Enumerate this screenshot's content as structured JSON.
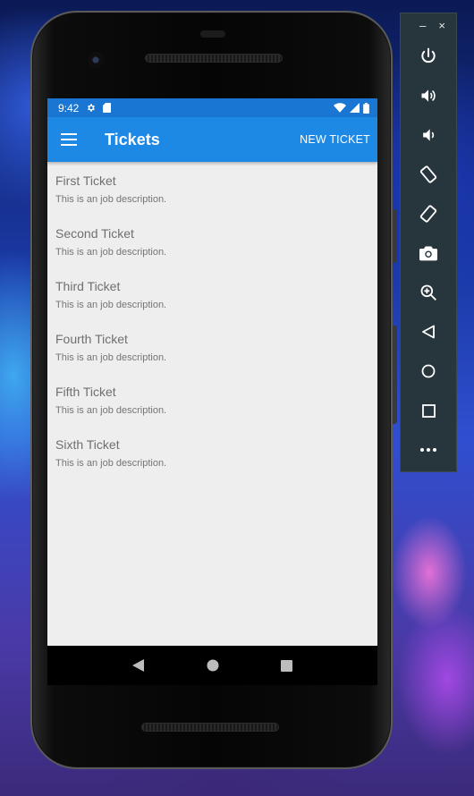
{
  "status_bar": {
    "time": "9:42"
  },
  "app_bar": {
    "title": "Tickets",
    "action_label": "NEW TICKET"
  },
  "tickets": [
    {
      "title": "First Ticket",
      "description": "This is an job description."
    },
    {
      "title": "Second Ticket",
      "description": "This is an job description."
    },
    {
      "title": "Third Ticket",
      "description": "This is an job description."
    },
    {
      "title": "Fourth Ticket",
      "description": "This is an job description."
    },
    {
      "title": "Fifth Ticket",
      "description": "This is an job description."
    },
    {
      "title": "Sixth Ticket",
      "description": "This is an job description."
    }
  ],
  "colors": {
    "primary": "#1e88e5",
    "primary_dark": "#1976d2",
    "list_background": "#eeeeee",
    "emulator_toolbar": "#27363c"
  },
  "icons": {
    "status": [
      "settings-icon",
      "sd-card-icon",
      "wifi-icon",
      "signal-icon",
      "battery-icon"
    ],
    "nav": [
      "back-icon",
      "home-icon",
      "recents-icon"
    ],
    "toolbar": [
      "power-icon",
      "volume-up-icon",
      "volume-down-icon",
      "rotate-left-icon",
      "rotate-right-icon",
      "camera-icon",
      "zoom-icon",
      "back-icon",
      "home-icon",
      "overview-icon",
      "more-icon"
    ]
  },
  "toolbar": {
    "minimize": "–",
    "close": "×"
  }
}
